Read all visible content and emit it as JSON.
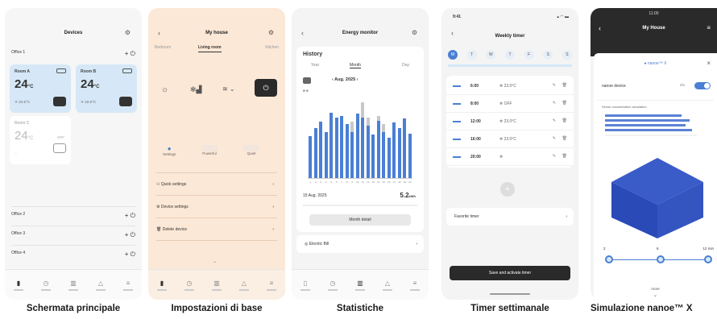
{
  "captions": [
    "Schermata principale",
    "Impostazioni di base",
    "Statistiche",
    "Timer settimanale",
    "Simulazione nanoe™ X"
  ],
  "s1": {
    "title": "Devices",
    "office1": "Office 1",
    "roomA": {
      "name": "Room A",
      "temp": "24",
      "unit": "°C",
      "sub": "22.5°C"
    },
    "roomB": {
      "name": "Room B",
      "temp": "24",
      "unit": "°C",
      "sub": "22.5°C"
    },
    "roomC": {
      "name": "Room C",
      "temp": "24",
      "unit": "°C",
      "sub": "--",
      "status": "OFF"
    },
    "offices": [
      "Office 2",
      "Office 3",
      "Office 4"
    ]
  },
  "s2": {
    "title": "My house",
    "tabs": [
      "Bedroom",
      "Living room",
      "Kitchen"
    ],
    "modes": [
      "Settings",
      "Powerful",
      "Quiet"
    ],
    "menu": [
      "Quick settings",
      "Device settings",
      "Delete device"
    ]
  },
  "s3": {
    "title": "Energy monitor",
    "heading": "History",
    "tabs": [
      "Year",
      "Month",
      "Day"
    ],
    "period": "Aug. 2025",
    "date": "15 Aug. 2025",
    "value": "5.2",
    "unit": "kWh",
    "detail": "Month detail",
    "bill": "Electric Bill",
    "chart_data": {
      "type": "bar",
      "categories": [
        "1",
        "2",
        "3",
        "4",
        "5",
        "6",
        "7",
        "8",
        "9",
        "10",
        "11",
        "12",
        "13",
        "14",
        "15",
        "16",
        "17",
        "18",
        "19",
        "20"
      ],
      "series": [
        {
          "values": [
            4.2,
            5.0,
            5.6,
            4.6,
            6.5,
            6.0,
            6.2,
            5.4,
            4.6,
            6.4,
            6.0,
            5.2,
            4.3,
            5.7,
            4.6,
            4.0,
            5.5,
            5.0,
            5.9,
            4.4
          ]
        },
        {
          "values": [
            0.0,
            0.0,
            0.0,
            0.0,
            0.0,
            0.0,
            0.0,
            0.0,
            1.0,
            0.0,
            1.5,
            0.8,
            0.0,
            0.5,
            0.8,
            0.0,
            0.0,
            0.0,
            0.0,
            0.0
          ]
        }
      ],
      "ylim": [
        0,
        8
      ]
    }
  },
  "s4": {
    "status_time": "9:41",
    "title": "Weekly timer",
    "days": [
      "M",
      "T",
      "W",
      "T",
      "F",
      "S",
      "S"
    ],
    "slots": [
      {
        "time": "6:00",
        "mode": "23.0°C"
      },
      {
        "time": "8:00",
        "mode": "OFF"
      },
      {
        "time": "12:00",
        "mode": "23.0°C"
      },
      {
        "time": "16:00",
        "mode": "23.0°C"
      },
      {
        "time": "20:00",
        "mode": ""
      }
    ],
    "favorite": "Favorite timer",
    "save": "Save and activate timer"
  },
  "s5": {
    "status_time": "11:00",
    "title": "My House",
    "brand": "nanoe™ X",
    "device": "nanoe device",
    "toggle": "On",
    "sim_title": "Sense concentration simulation",
    "steps": [
      "2",
      "6",
      "12 min"
    ],
    "more": "more"
  },
  "colors": {
    "accent": "#4a7fd4",
    "peach": "#fce8d6",
    "light_blue": "#d6e8f7",
    "dark": "#2a2a2a"
  }
}
